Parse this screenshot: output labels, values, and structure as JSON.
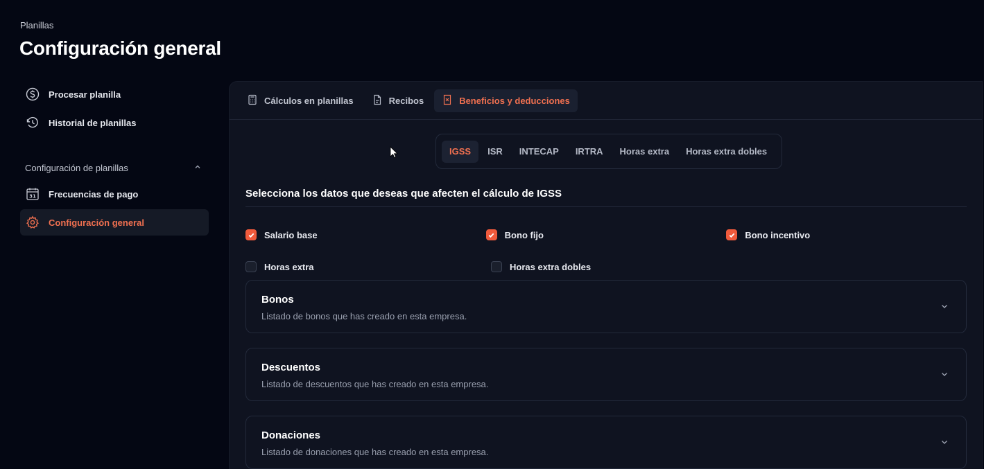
{
  "breadcrumb": "Planillas",
  "page_title": "Configuración general",
  "sidebar": {
    "items_top": [
      {
        "label": "Procesar planilla",
        "icon": "dollar-circle-icon"
      },
      {
        "label": "Historial de planillas",
        "icon": "history-icon"
      }
    ],
    "section_label": "Configuración de planillas",
    "items_section": [
      {
        "label": "Frecuencias de pago",
        "icon": "calendar-icon",
        "icon_text": "31"
      },
      {
        "label": "Configuración general",
        "icon": "gear-icon",
        "active": true
      }
    ]
  },
  "tabs": [
    {
      "label": "Cálculos en planillas",
      "icon": "calculator-icon"
    },
    {
      "label": "Recibos",
      "icon": "document-icon"
    },
    {
      "label": "Beneficios y deducciones",
      "icon": "receipt-icon",
      "active": true
    }
  ],
  "subtabs": [
    "IGSS",
    "ISR",
    "INTECAP",
    "IRTRA",
    "Horas extra",
    "Horas extra dobles"
  ],
  "active_subtab": "IGSS",
  "select_title": "Selecciona los datos que deseas que afecten el cálculo de IGSS",
  "checkboxes": [
    {
      "label": "Salario base",
      "checked": true
    },
    {
      "label": "Bono fijo",
      "checked": true
    },
    {
      "label": "Bono incentivo",
      "checked": true
    },
    {
      "label": "Horas extra",
      "checked": false
    },
    {
      "label": "Horas extra dobles",
      "checked": false
    }
  ],
  "accordions": [
    {
      "title": "Bonos",
      "description": "Listado de bonos que has creado en esta empresa."
    },
    {
      "title": "Descuentos",
      "description": "Listado de descuentos que has creado en esta empresa."
    },
    {
      "title": "Donaciones",
      "description": "Listado de donaciones que has creado en esta empresa."
    }
  ],
  "colors": {
    "accent": "#f07050",
    "background": "#040713",
    "panel": "#0f1320",
    "checkbox_checked": "#f05a3c"
  }
}
